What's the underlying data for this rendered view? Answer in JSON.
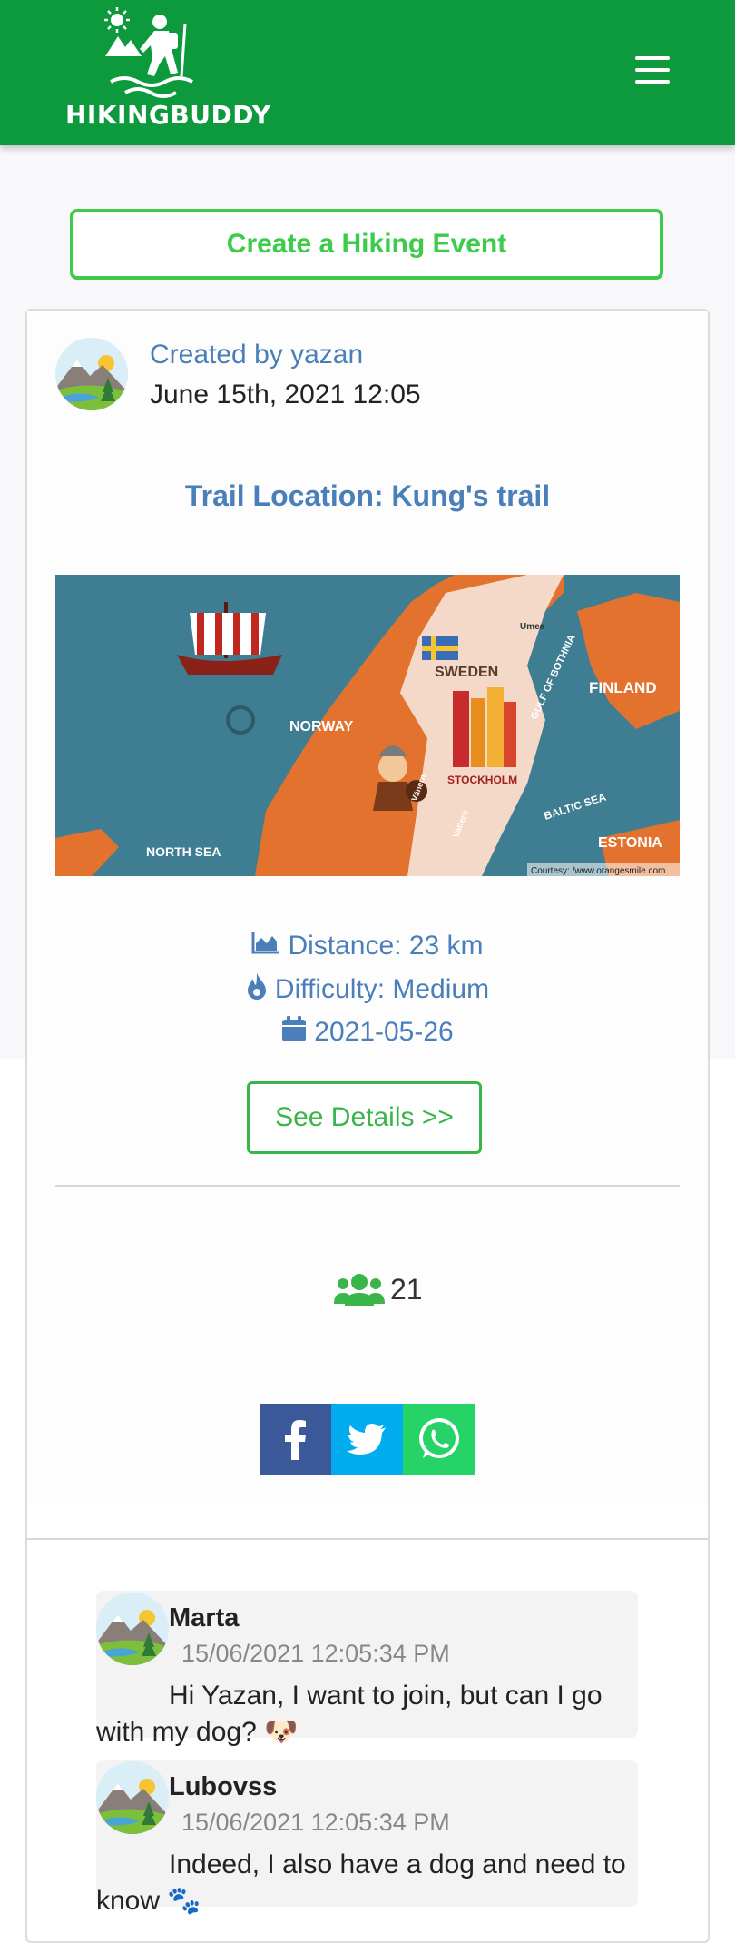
{
  "header": {
    "logo_text": "HIKINGBUDDY",
    "menu_icon": "hamburger-menu-icon",
    "background_color": "#0c9a3c"
  },
  "create_event_label": "Create a Hiking Event",
  "event": {
    "created_by": "Created by yazan",
    "created_at": "June 15th, 2021 12:05",
    "trail_title": "Trail Location: Kung's trail",
    "map": {
      "labels": {
        "sweden": "SWEDEN",
        "finland": "FINLAND",
        "norway": "NORWAY",
        "stockholm": "STOCKHOLM",
        "baltic": "BALTIC SEA",
        "estonia": "ESTONIA",
        "north_sea": "NORTH SEA",
        "gulf": "GULF OF BOTHNIA",
        "umea": "Umea",
        "vastern": "Vänern",
        "vattern": "Vättern",
        "courtesy": "Courtesy: /www.orangesmile.com"
      }
    },
    "distance": "Distance: 23 km",
    "difficulty": "Difficulty: Medium",
    "date": "2021-05-26",
    "see_details_label": "See Details >>",
    "participants_count": "21"
  },
  "share": {
    "facebook_icon": "facebook-icon",
    "twitter_icon": "twitter-icon",
    "whatsapp_icon": "whatsapp-icon",
    "facebook_color": "#3b5998",
    "twitter_color": "#00aced",
    "whatsapp_color": "#25d366"
  },
  "comments": [
    {
      "author": "Marta",
      "time": "15/06/2021 12:05:34 PM",
      "text": "Hi Yazan, I want to join, but can I go with my dog? 🐶"
    },
    {
      "author": "Lubovss",
      "time": "15/06/2021 12:05:34 PM",
      "text": "Indeed, I also have a dog and need to know 🐾"
    }
  ],
  "colors": {
    "accent_green": "#3ccb4a",
    "link_blue": "#4a7fb9"
  }
}
